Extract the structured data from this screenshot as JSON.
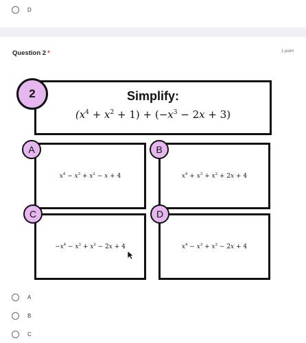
{
  "prev_option": {
    "label": "D"
  },
  "question": {
    "title": "Question 2",
    "required_mark": "*",
    "points": "1 point"
  },
  "figure": {
    "number": "2",
    "prompt": "Simplify:",
    "expression": "(x⁴ + x² + 1) + (−x³ − 2x + 3)",
    "answers": [
      {
        "letter": "A",
        "expression": "x⁴ − x³ + x² − x + 4"
      },
      {
        "letter": "B",
        "expression": "x⁴ + x³ + x² + 2x + 4"
      },
      {
        "letter": "C",
        "expression": "−x⁴ − x³ + x² − 2x + 4"
      },
      {
        "letter": "D",
        "expression": "x⁴ − x³ + x² − 2x + 4"
      }
    ]
  },
  "options": [
    {
      "label": "A"
    },
    {
      "label": "B"
    },
    {
      "label": "C"
    }
  ],
  "colors": {
    "circle_fill": "#e6b6ef",
    "required": "#d93025",
    "divider": "#eef0f6"
  }
}
